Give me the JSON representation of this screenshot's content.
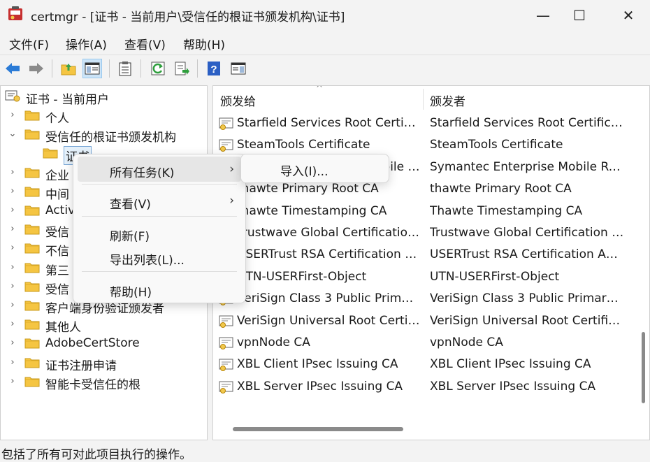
{
  "window": {
    "title": "certmgr - [证书 - 当前用户\\受信任的根证书颁发机构\\证书]",
    "minimize_glyph": "—",
    "maximize_glyph": "☐",
    "close_glyph": "✕"
  },
  "menubar": [
    "文件(F)",
    "操作(A)",
    "查看(V)",
    "帮助(H)"
  ],
  "toolbar": {
    "icons": [
      "back-arrow-icon",
      "forward-arrow-icon",
      "up-folder-icon",
      "show-hide-tree-icon",
      "clipboard-icon",
      "refresh-icon",
      "export-list-icon",
      "help-icon",
      "properties-pane-icon"
    ],
    "active": "show-hide-tree-icon"
  },
  "tree": {
    "root": "证书 - 当前用户",
    "items": [
      {
        "label": "个人",
        "indent": 0,
        "chevron": "›"
      },
      {
        "label": "受信任的根证书颁发机构",
        "indent": 0,
        "chevron": "⌄"
      },
      {
        "label": "证书",
        "indent": 1,
        "chevron": ""
      },
      {
        "label": "企业",
        "indent": 0,
        "chevron": "›"
      },
      {
        "label": "中间",
        "indent": 0,
        "chevron": "›"
      },
      {
        "label": "Activ",
        "indent": 0,
        "chevron": "›"
      },
      {
        "label": "受信",
        "indent": 0,
        "chevron": "›"
      },
      {
        "label": "不信",
        "indent": 0,
        "chevron": "›"
      },
      {
        "label": "第三",
        "indent": 0,
        "chevron": "›"
      },
      {
        "label": "受信",
        "indent": 0,
        "chevron": "›"
      },
      {
        "label": "客户端身份验证颁发者",
        "indent": 0,
        "chevron": "›"
      },
      {
        "label": "其他人",
        "indent": 0,
        "chevron": "›"
      },
      {
        "label": "AdobeCertStore",
        "indent": 0,
        "chevron": "›"
      },
      {
        "label": "证书注册申请",
        "indent": 0,
        "chevron": "›"
      },
      {
        "label": "智能卡受信任的根",
        "indent": 0,
        "chevron": "›"
      }
    ]
  },
  "list": {
    "columns": [
      "颁发给",
      "颁发者"
    ],
    "sort_caret": "^",
    "rows": [
      [
        "Starfield Services Root Certific...",
        "Starfield Services Root Certificat..."
      ],
      [
        "SteamTools Certificate",
        "SteamTools Certificate"
      ],
      [
        "Symantec Enterprise Mobile Root ... R...",
        "Symantec Enterprise Mobile Roo..."
      ],
      [
        "thawte Primary Root CA",
        "thawte Primary Root CA"
      ],
      [
        "thawte Timestamping CA",
        "Thawte Timestamping CA"
      ],
      [
        "Trustwave Global Certification ...",
        "Trustwave Global Certification A..."
      ],
      [
        "USERTrust RSA Certification A...",
        "USERTrust RSA Certification Aut..."
      ],
      [
        "UTN-USERFirst-Object",
        "UTN-USERFirst-Object"
      ],
      [
        "VeriSign Class 3 Public Primary...",
        "VeriSign Class 3 Public Primary C..."
      ],
      [
        "VeriSign Universal Root Certifi...",
        "VeriSign Universal Root Certifica..."
      ],
      [
        "vpnNode CA",
        "vpnNode CA"
      ],
      [
        "XBL Client IPsec Issuing CA",
        "XBL Client IPsec Issuing CA"
      ],
      [
        "XBL Server IPsec Issuing CA",
        "XBL Server IPsec Issuing CA"
      ]
    ]
  },
  "context_menu": {
    "items": [
      {
        "label": "所有任务(K)",
        "arrow": "›"
      },
      {
        "label": "查看(V)",
        "arrow": "›"
      },
      {
        "label": "刷新(F)",
        "arrow": ""
      },
      {
        "label": "导出列表(L)...",
        "arrow": ""
      },
      {
        "label": "帮助(H)",
        "arrow": ""
      }
    ]
  },
  "submenu": {
    "items": [
      "导入(I)..."
    ]
  },
  "status": "包括了所有可对此项目执行的操作。",
  "colors": {
    "folder": "#f5c542",
    "accent": "#0078d4",
    "hover": "#e6e6e6"
  }
}
